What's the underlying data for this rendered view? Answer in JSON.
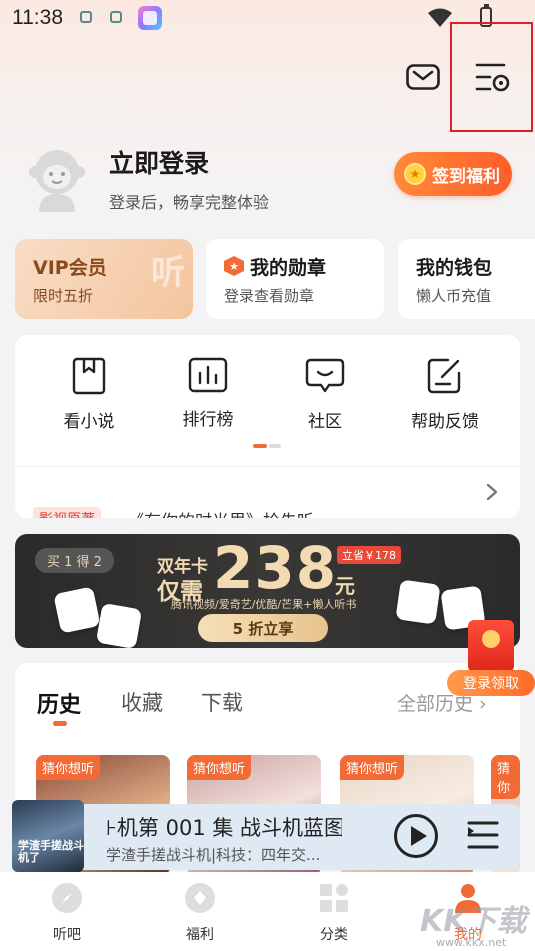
{
  "status_bar": {
    "time": "11:38"
  },
  "profile": {
    "title": "立即登录",
    "subtitle": "登录后，畅享完整体验",
    "signin_button": "签到福利"
  },
  "cards": {
    "vip": {
      "title": "VIP会员",
      "subtitle": "限时五折",
      "deco": "听"
    },
    "badge": {
      "title": "我的勋章",
      "subtitle": "登录查看勋章"
    },
    "wallet": {
      "title": "我的钱包",
      "subtitle": "懒人币充值"
    }
  },
  "tools": [
    {
      "label": "看小说",
      "icon": "book-bookmark-icon"
    },
    {
      "label": "排行榜",
      "icon": "bar-chart-icon"
    },
    {
      "label": "社区",
      "icon": "chat-bubble-icon"
    },
    {
      "label": "帮助反馈",
      "icon": "edit-note-icon"
    }
  ],
  "promo": {
    "tag": "影视原著",
    "text": "《有你的时光里》抢先听"
  },
  "banner": {
    "buy_tag": "买 1 得 2",
    "line1": "双年卡",
    "line2": "仅需",
    "price": "238",
    "unit": "元",
    "save": "立省￥178",
    "partners": "腾讯视频/爱奇艺/优酷/芒果+懒人听书",
    "cta": "5 折立享"
  },
  "login_reward": "登录领取",
  "history": {
    "tabs": [
      "历史",
      "收藏",
      "下载"
    ],
    "all_label": "全部历史",
    "book_tag": "猜你想听"
  },
  "player": {
    "title": "⊦机第 001 集 战斗机蓝图",
    "subtitle": "学渣手搓战斗机|科技：四年交...",
    "cover_text": "学渣手搓战斗机了"
  },
  "bottom_nav": [
    {
      "label": "听吧",
      "icon": "compass-icon"
    },
    {
      "label": "福利",
      "icon": "gift-diamond-icon"
    },
    {
      "label": "分类",
      "icon": "category-grid-icon"
    },
    {
      "label": "我的",
      "icon": "profile-icon",
      "active": true
    }
  ],
  "watermark": {
    "text": "KK下载",
    "url": "www.kkx.net"
  },
  "colors": {
    "accent": "#f26a35",
    "highlight": "#e01f2a"
  }
}
